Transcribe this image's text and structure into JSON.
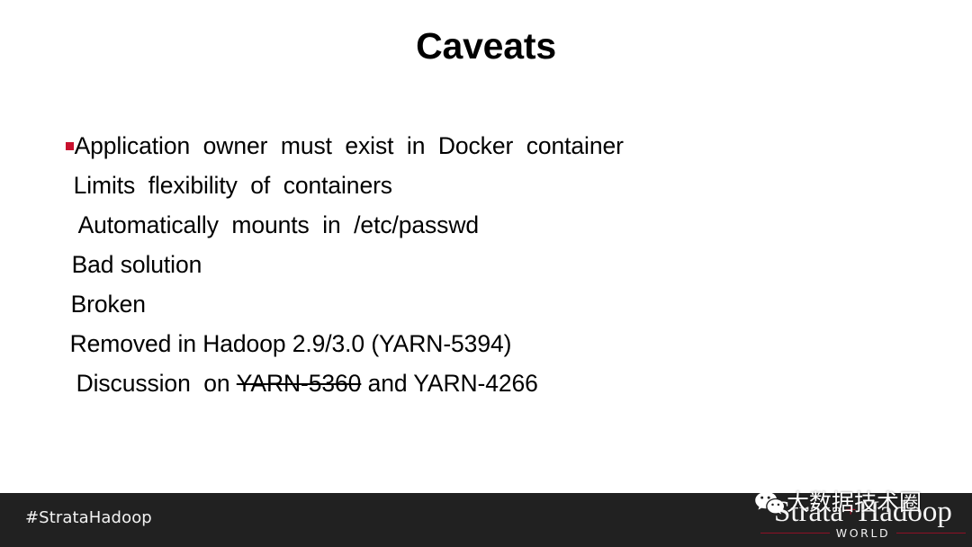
{
  "slide": {
    "title": "Caveats",
    "background_color": "#FFFFFF",
    "bullet_color": "#C8102E"
  },
  "body": {
    "lines": [
      {
        "text": "Application  owner  must  exist  in  Docker  container",
        "bulleted": true
      },
      {
        "text": "Limits  flexibility  of  containers",
        "bulleted": false
      },
      {
        "text": "Automatically  mounts  in  /etc/passwd",
        "bulleted": false
      },
      {
        "text": "Bad solution",
        "bulleted": false
      },
      {
        "text": "Broken",
        "bulleted": false
      },
      {
        "text": "Removed in Hadoop 2.9/3.0 (YARN-5394)",
        "bulleted": false
      }
    ],
    "last_line": {
      "prefix": "Discussion  on ",
      "struck": "YARN-5360",
      "suffix": " and YARN-4266"
    }
  },
  "footer": {
    "background_color": "#212121",
    "hashtag": "#StrataHadoop",
    "logo": {
      "word_left": "Strata",
      "plus": "+",
      "word_right": "Hadoop",
      "world": "WORLD",
      "rule_color": "#8E1026"
    },
    "watermark": {
      "icon": "wechat-icon",
      "chinese_text": "大数据技术圈"
    }
  }
}
